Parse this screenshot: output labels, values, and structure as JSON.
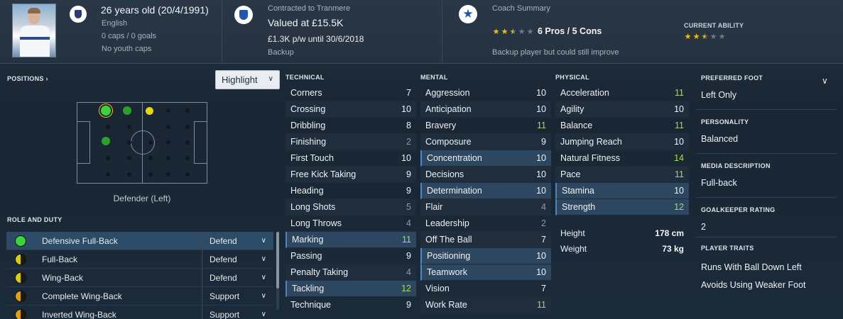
{
  "header": {
    "age_dob": "26 years old (20/4/1991)",
    "nationality": "English",
    "caps": "0 caps / 0 goals",
    "youth_caps": "No youth caps",
    "contract": "Contracted to Tranmere",
    "value": "Valued at £15.5K",
    "wage": "£1.3K p/w until 30/6/2018",
    "squad_status": "Backup",
    "coach_summary_title": "Coach Summary",
    "pros_cons": "6 Pros / 5 Cons",
    "coach_potential_stars": 2.5,
    "coach_description": "Backup player but could still improve",
    "current_ability_label": "CURRENT ABILITY",
    "current_ability_stars": 2.5
  },
  "positions": {
    "title": "POSITIONS ›",
    "highlight_label": "Highlight",
    "position_label": "Defender (Left)"
  },
  "roles": {
    "title": "ROLE AND DUTY",
    "items": [
      {
        "name": "Defensive Full-Back",
        "duty": "Defend"
      },
      {
        "name": "Full-Back",
        "duty": "Defend"
      },
      {
        "name": "Wing-Back",
        "duty": "Defend"
      },
      {
        "name": "Complete Wing-Back",
        "duty": "Support"
      },
      {
        "name": "Inverted Wing-Back",
        "duty": "Support"
      }
    ]
  },
  "technical": {
    "title": "TECHNICAL",
    "items": [
      {
        "label": "Corners",
        "value": "7"
      },
      {
        "label": "Crossing",
        "value": "10"
      },
      {
        "label": "Dribbling",
        "value": "8"
      },
      {
        "label": "Finishing",
        "value": "2"
      },
      {
        "label": "First Touch",
        "value": "10"
      },
      {
        "label": "Free Kick Taking",
        "value": "9"
      },
      {
        "label": "Heading",
        "value": "9"
      },
      {
        "label": "Long Shots",
        "value": "5"
      },
      {
        "label": "Long Throws",
        "value": "4"
      },
      {
        "label": "Marking",
        "value": "11"
      },
      {
        "label": "Passing",
        "value": "9"
      },
      {
        "label": "Penalty Taking",
        "value": "4"
      },
      {
        "label": "Tackling",
        "value": "12"
      },
      {
        "label": "Technique",
        "value": "9"
      }
    ]
  },
  "mental": {
    "title": "MENTAL",
    "items": [
      {
        "label": "Aggression",
        "value": "10"
      },
      {
        "label": "Anticipation",
        "value": "10"
      },
      {
        "label": "Bravery",
        "value": "11"
      },
      {
        "label": "Composure",
        "value": "9"
      },
      {
        "label": "Concentration",
        "value": "10"
      },
      {
        "label": "Decisions",
        "value": "10"
      },
      {
        "label": "Determination",
        "value": "10"
      },
      {
        "label": "Flair",
        "value": "4"
      },
      {
        "label": "Leadership",
        "value": "2"
      },
      {
        "label": "Off The Ball",
        "value": "7"
      },
      {
        "label": "Positioning",
        "value": "10"
      },
      {
        "label": "Teamwork",
        "value": "10"
      },
      {
        "label": "Vision",
        "value": "7"
      },
      {
        "label": "Work Rate",
        "value": "11"
      }
    ]
  },
  "physical": {
    "title": "PHYSICAL",
    "items": [
      {
        "label": "Acceleration",
        "value": "11"
      },
      {
        "label": "Agility",
        "value": "10"
      },
      {
        "label": "Balance",
        "value": "11"
      },
      {
        "label": "Jumping Reach",
        "value": "10"
      },
      {
        "label": "Natural Fitness",
        "value": "14"
      },
      {
        "label": "Pace",
        "value": "11"
      },
      {
        "label": "Stamina",
        "value": "10"
      },
      {
        "label": "Strength",
        "value": "12"
      }
    ],
    "height_label": "Height",
    "height_value": "178 cm",
    "weight_label": "Weight",
    "weight_value": "73 kg"
  },
  "info": {
    "preferred_foot_title": "PREFERRED FOOT",
    "preferred_foot": "Left Only",
    "personality_title": "PERSONALITY",
    "personality": "Balanced",
    "media_title": "MEDIA DESCRIPTION",
    "media": "Full-back",
    "gk_title": "GOALKEEPER RATING",
    "gk": "2",
    "traits_title": "PLAYER TRAITS",
    "traits": [
      "Runs With Ball Down Left",
      "Avoids Using Weaker Foot"
    ]
  },
  "colors": {
    "good_value": "#9be05a",
    "low_value": "#8d99a5",
    "highlight_row": "#2e4760",
    "star": "#f0c400"
  }
}
